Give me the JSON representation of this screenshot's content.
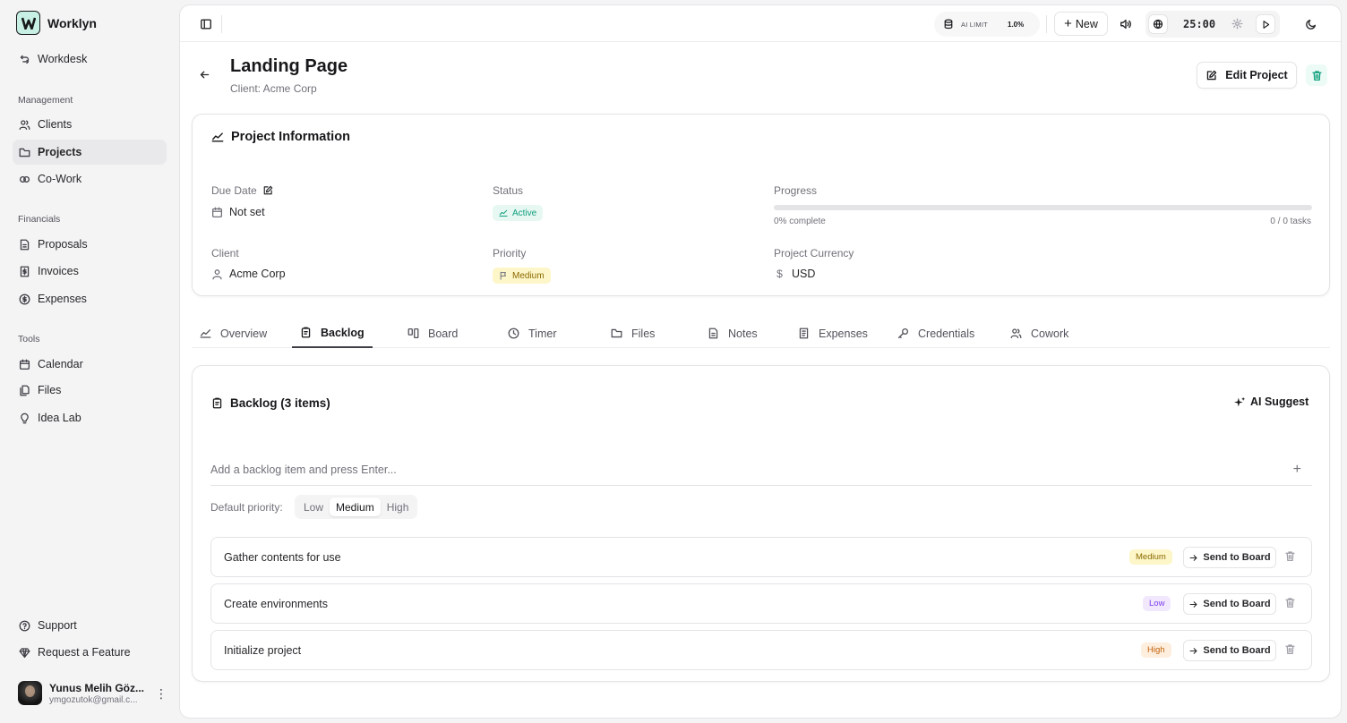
{
  "app": {
    "name": "Worklyn"
  },
  "sidebar": {
    "top_item": "Workdesk",
    "sections": [
      {
        "label": "Management",
        "items": [
          "Clients",
          "Projects",
          "Co-Work"
        ]
      },
      {
        "label": "Financials",
        "items": [
          "Proposals",
          "Invoices",
          "Expenses"
        ]
      },
      {
        "label": "Tools",
        "items": [
          "Calendar",
          "Files",
          "Idea Lab"
        ]
      }
    ],
    "active_item": "Projects",
    "footer_items": [
      "Support",
      "Request a Feature"
    ],
    "user": {
      "name": "Yunus Melih Göz...",
      "email": "ymgozutok@gmail.c..."
    }
  },
  "topbar": {
    "ai_limit_label": "AI LIMIT",
    "ai_limit_value": "1.0%",
    "new_label": "New",
    "timer": "25:00"
  },
  "header": {
    "title": "Landing Page",
    "subtitle": "Client: Acme Corp",
    "edit_label": "Edit Project"
  },
  "info": {
    "title": "Project Information",
    "due_date_label": "Due Date",
    "due_date_value": "Not set",
    "status_label": "Status",
    "status_value": "Active",
    "progress_label": "Progress",
    "progress_value": 0,
    "progress_text": "0% complete",
    "tasks_text": "0 / 0 tasks",
    "client_label": "Client",
    "client_value": "Acme Corp",
    "priority_label": "Priority",
    "priority_value": "Medium",
    "currency_label": "Project Currency",
    "currency_value": "USD"
  },
  "tabs": [
    "Overview",
    "Backlog",
    "Board",
    "Timer",
    "Files",
    "Notes",
    "Expenses",
    "Credentials",
    "Cowork"
  ],
  "active_tab": "Backlog",
  "backlog": {
    "title": "Backlog (3 items)",
    "ai_suggest": "AI Suggest",
    "input_placeholder": "Add a backlog item and press Enter...",
    "default_priority_label": "Default priority:",
    "priority_options": [
      "Low",
      "Medium",
      "High"
    ],
    "default_priority": "Medium",
    "send_label": "Send to Board",
    "items": [
      {
        "title": "Gather contents for use",
        "priority": "Medium"
      },
      {
        "title": "Create environments",
        "priority": "Low"
      },
      {
        "title": "Initialize project",
        "priority": "High"
      }
    ]
  },
  "colors": {
    "accent": "#0f9e7b",
    "status_active_bg": "#e7f8f3",
    "medium_bg": "#fdf6c9",
    "low_bg": "#f1e8fd",
    "high_bg": "#fdeedd"
  }
}
